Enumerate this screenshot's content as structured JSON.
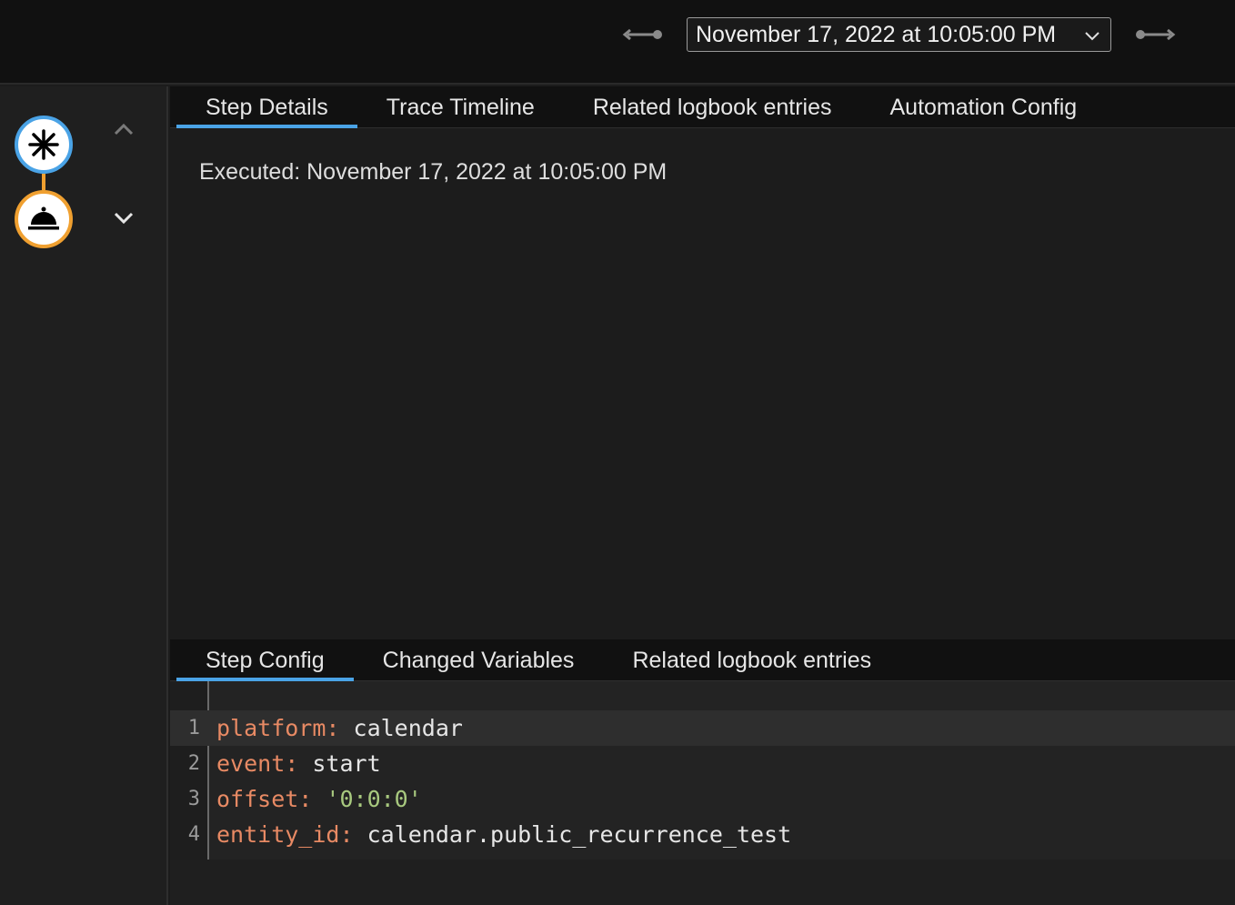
{
  "header": {
    "selected_trace": "November 17, 2022 at 10:05:00 PM",
    "prev_icon": "arrow-left-icon",
    "next_icon": "arrow-right-icon"
  },
  "sidebar": {
    "nodes": [
      {
        "type": "trigger",
        "icon": "asterisk-icon",
        "color": "#4aa3e6"
      },
      {
        "type": "action",
        "icon": "bell-service-icon",
        "color": "#f0a030"
      }
    ]
  },
  "main": {
    "tabs": [
      {
        "label": "Step Details",
        "active": true
      },
      {
        "label": "Trace Timeline",
        "active": false
      },
      {
        "label": "Related logbook entries",
        "active": false
      },
      {
        "label": "Automation Config",
        "active": false
      }
    ],
    "executed": "Executed: November 17, 2022 at 10:05:00 PM"
  },
  "step": {
    "tabs": [
      {
        "label": "Step Config",
        "active": true
      },
      {
        "label": "Changed Variables",
        "active": false
      },
      {
        "label": "Related logbook entries",
        "active": false
      }
    ],
    "code_lines": [
      {
        "num": "1",
        "key": "platform:",
        "value": " calendar",
        "value_type": "plain"
      },
      {
        "num": "2",
        "key": "event:",
        "value": " start",
        "value_type": "plain"
      },
      {
        "num": "3",
        "key": "offset:",
        "value": " '0:0:0'",
        "value_type": "string"
      },
      {
        "num": "4",
        "key": "entity_id:",
        "value": " calendar.public_recurrence_test",
        "value_type": "plain"
      }
    ]
  },
  "colors": {
    "accent": "#4aa3e6",
    "action": "#f0a030",
    "yaml_key": "#e88a64",
    "yaml_string": "#a8c97f"
  }
}
